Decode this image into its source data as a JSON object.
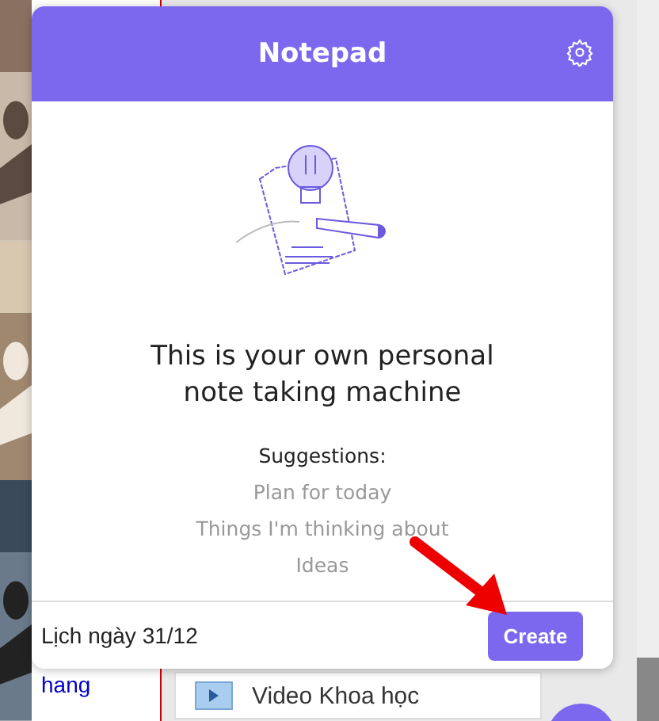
{
  "background": {
    "link_text": "hang",
    "list_item": "Video Khoa học"
  },
  "notepad": {
    "title": "Notepad",
    "heading": "This is your own personal note taking machine",
    "suggestions_label": "Suggestions:",
    "suggestions": [
      "Plan for today",
      "Things I'm thinking about",
      "Ideas"
    ],
    "note_input": {
      "value": "Lịch ngày 31/12"
    },
    "create_button": "Create"
  }
}
